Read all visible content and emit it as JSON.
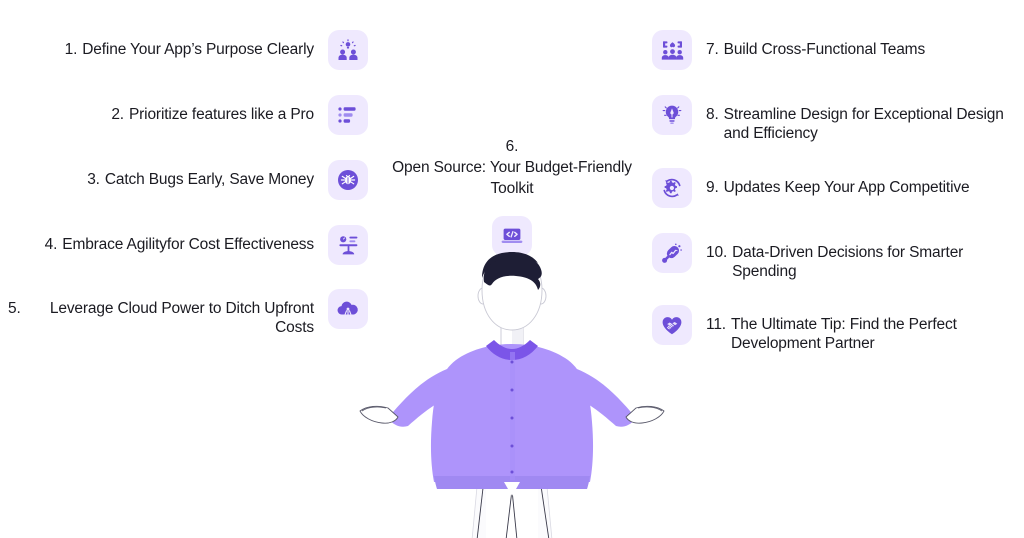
{
  "meta": {
    "accent": "#6d4fd8",
    "accent_light": "#ae94fb",
    "tile_bg": "#efe9fe",
    "text_color": "#1b1b22",
    "background": "#ffffff"
  },
  "left_column": [
    {
      "number": "1.",
      "label": "Define Your App’s Purpose Clearly",
      "icon": "people-idea-icon"
    },
    {
      "number": "2.",
      "label": "Prioritize features like a Pro",
      "icon": "priority-list-icon"
    },
    {
      "number": "3.",
      "label": "Catch Bugs Early, Save Money",
      "icon": "bug-icon"
    },
    {
      "number": "4.",
      "label": "Embrace Agilityfor Cost Effectiveness",
      "icon": "balance-scale-icon"
    },
    {
      "number": "5.",
      "label": "Leverage Cloud Power to Ditch Upfront Costs",
      "icon": "cloud-icon"
    }
  ],
  "center_item": {
    "number": "6.",
    "label": "Open Source: Your Budget-Friendly Toolkit",
    "icon": "code-laptop-icon"
  },
  "right_column": [
    {
      "number": "7.",
      "label": "Build Cross-Functional Teams",
      "icon": "team-group-icon"
    },
    {
      "number": "8.",
      "label": "Streamline Design for Exceptional Design and Efficiency",
      "icon": "bulb-pen-icon"
    },
    {
      "number": "9.",
      "label": "Updates Keep Your App Competitive",
      "icon": "gear-refresh-icon"
    },
    {
      "number": "10.",
      "label": "Data-Driven Decisions for Smarter Spending",
      "icon": "growth-arrow-icon"
    },
    {
      "number": "11.",
      "label": "The Ultimate Tip: Find the Perfect Development Partner",
      "icon": "handshake-heart-icon"
    }
  ],
  "illustration": {
    "name": "man-open-arms-illustration",
    "shirt_color": "#ae94fb",
    "collar_color": "#7b55e8",
    "hair_color": "#1e1e35",
    "skin_color": "#ffffff",
    "pants_color": "#fbfbfd"
  }
}
